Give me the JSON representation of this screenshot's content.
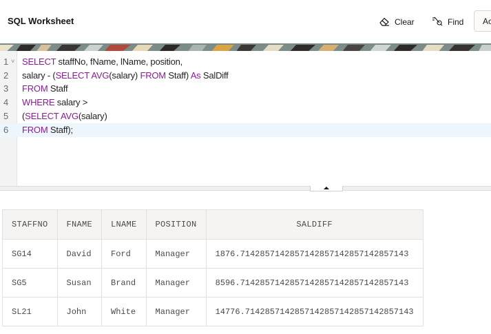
{
  "header": {
    "title": "SQL Worksheet",
    "clear_label": "Clear",
    "find_label": "Find",
    "actions_label": "Actions"
  },
  "editor": {
    "line_numbers": [
      "1",
      "2",
      "3",
      "4",
      "5",
      "6"
    ],
    "active_line": 6,
    "lines": [
      [
        {
          "t": "SELECT",
          "k": 1
        },
        {
          "t": " staffNo, fName, lName, position,",
          "k": 0
        }
      ],
      [
        {
          "t": "salary - (",
          "k": 0
        },
        {
          "t": "SELECT",
          "k": 1
        },
        {
          "t": " ",
          "k": 0
        },
        {
          "t": "AVG",
          "k": 1
        },
        {
          "t": "(salary) ",
          "k": 0
        },
        {
          "t": "FROM",
          "k": 1
        },
        {
          "t": " Staff) ",
          "k": 0
        },
        {
          "t": "As",
          "k": 1
        },
        {
          "t": " SalDiff",
          "k": 0
        }
      ],
      [
        {
          "t": "FROM",
          "k": 1
        },
        {
          "t": " Staff",
          "k": 0
        }
      ],
      [
        {
          "t": "WHERE",
          "k": 1
        },
        {
          "t": " salary >",
          "k": 0
        }
      ],
      [
        {
          "t": "(",
          "k": 0
        },
        {
          "t": "SELECT",
          "k": 1
        },
        {
          "t": " ",
          "k": 0
        },
        {
          "t": "AVG",
          "k": 1
        },
        {
          "t": "(salary)",
          "k": 0
        }
      ],
      [
        {
          "t": "FROM",
          "k": 1
        },
        {
          "t": " Staff);",
          "k": 0
        }
      ]
    ]
  },
  "results": {
    "columns": [
      "STAFFNO",
      "FNAME",
      "LNAME",
      "POSITION",
      "SALDIFF"
    ],
    "rows": [
      [
        "SG14",
        "David",
        "Ford",
        "Manager",
        "1876.7142857142857142857142857142857143"
      ],
      [
        "SG5",
        "Susan",
        "Brand",
        "Manager",
        "8596.7142857142857142857142857142857143"
      ],
      [
        "SL21",
        "John",
        "White",
        "Manager",
        "14776.7142857142857142857142857142857143"
      ]
    ]
  },
  "icons": {
    "clear": "eraser-icon",
    "find": "find-replace-icon"
  }
}
